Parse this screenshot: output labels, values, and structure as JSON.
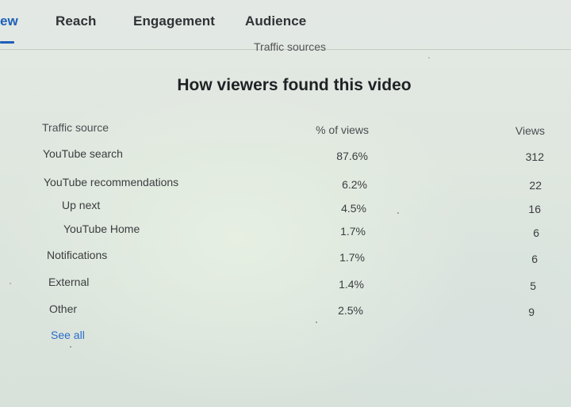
{
  "tabs": [
    {
      "label": "ew"
    },
    {
      "label": "Reach"
    },
    {
      "label": "Engagement"
    },
    {
      "label": "Audience"
    }
  ],
  "section_heading_partial": "Traffic sources",
  "card_title": "How viewers found this video",
  "columns": {
    "source": "Traffic source",
    "percent": "% of views",
    "views": "Views"
  },
  "rows": [
    {
      "source": "YouTube search",
      "percent": "87.6%",
      "views": "312"
    },
    {
      "source": "YouTube recommendations",
      "percent": "6.2%",
      "views": "22"
    },
    {
      "source": "Up next",
      "percent": "4.5%",
      "views": "16"
    },
    {
      "source": "YouTube Home",
      "percent": "1.7%",
      "views": "6"
    },
    {
      "source": "Notifications",
      "percent": "1.7%",
      "views": "6"
    },
    {
      "source": "External",
      "percent": "1.4%",
      "views": "5"
    },
    {
      "source": "Other",
      "percent": "2.5%",
      "views": "9"
    }
  ],
  "see_all_label": "See all",
  "colors": {
    "accent": "#1f5fb8",
    "link": "#2a6cc8"
  }
}
